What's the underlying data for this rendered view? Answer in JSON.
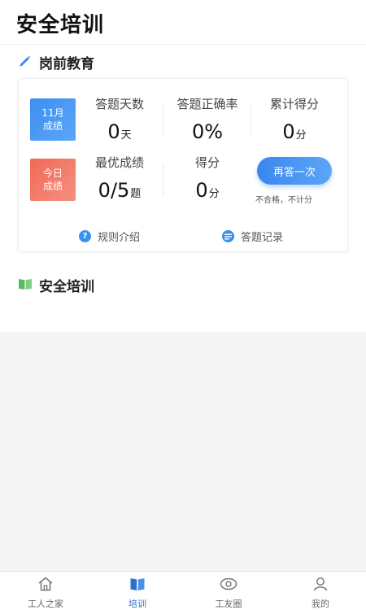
{
  "app": {
    "title": "安全培训"
  },
  "sections": {
    "pre_job": {
      "title": "岗前教育"
    },
    "training": {
      "title": "安全培训"
    }
  },
  "card": {
    "tiles": {
      "month": {
        "line1": "11月",
        "line2": "成绩"
      },
      "today": {
        "line1": "今日",
        "line2": "成绩"
      }
    },
    "stats": {
      "answer_days": {
        "label": "答题天数",
        "value": "0",
        "unit": "天"
      },
      "accuracy": {
        "label": "答题正确率",
        "value": "0%"
      },
      "total_score": {
        "label": "累计得分",
        "value": "0",
        "unit": "分"
      },
      "best_score": {
        "label": "最优成绩",
        "value": "0/5",
        "unit": "题"
      },
      "score": {
        "label": "得分",
        "value": "0",
        "unit": "分"
      }
    },
    "retry_button": "再答一次",
    "note": "不合格，不计分",
    "links": {
      "rules": {
        "label": "规则介绍",
        "icon": "question-icon"
      },
      "records": {
        "label": "答题记录",
        "icon": "list-icon"
      }
    }
  },
  "tabbar": {
    "active": "training",
    "items": [
      {
        "label": "工人之家",
        "icon": "home-icon"
      },
      {
        "label": "培训",
        "icon": "book-icon"
      },
      {
        "label": "工友圈",
        "icon": "eye-icon"
      },
      {
        "label": "我的",
        "icon": "user-icon"
      }
    ]
  },
  "colors": {
    "accent": "#3a86ee",
    "tile_blue": "#3d8ef0",
    "tile_red": "#f06a55",
    "section_icon_green": "#5cb85c"
  }
}
